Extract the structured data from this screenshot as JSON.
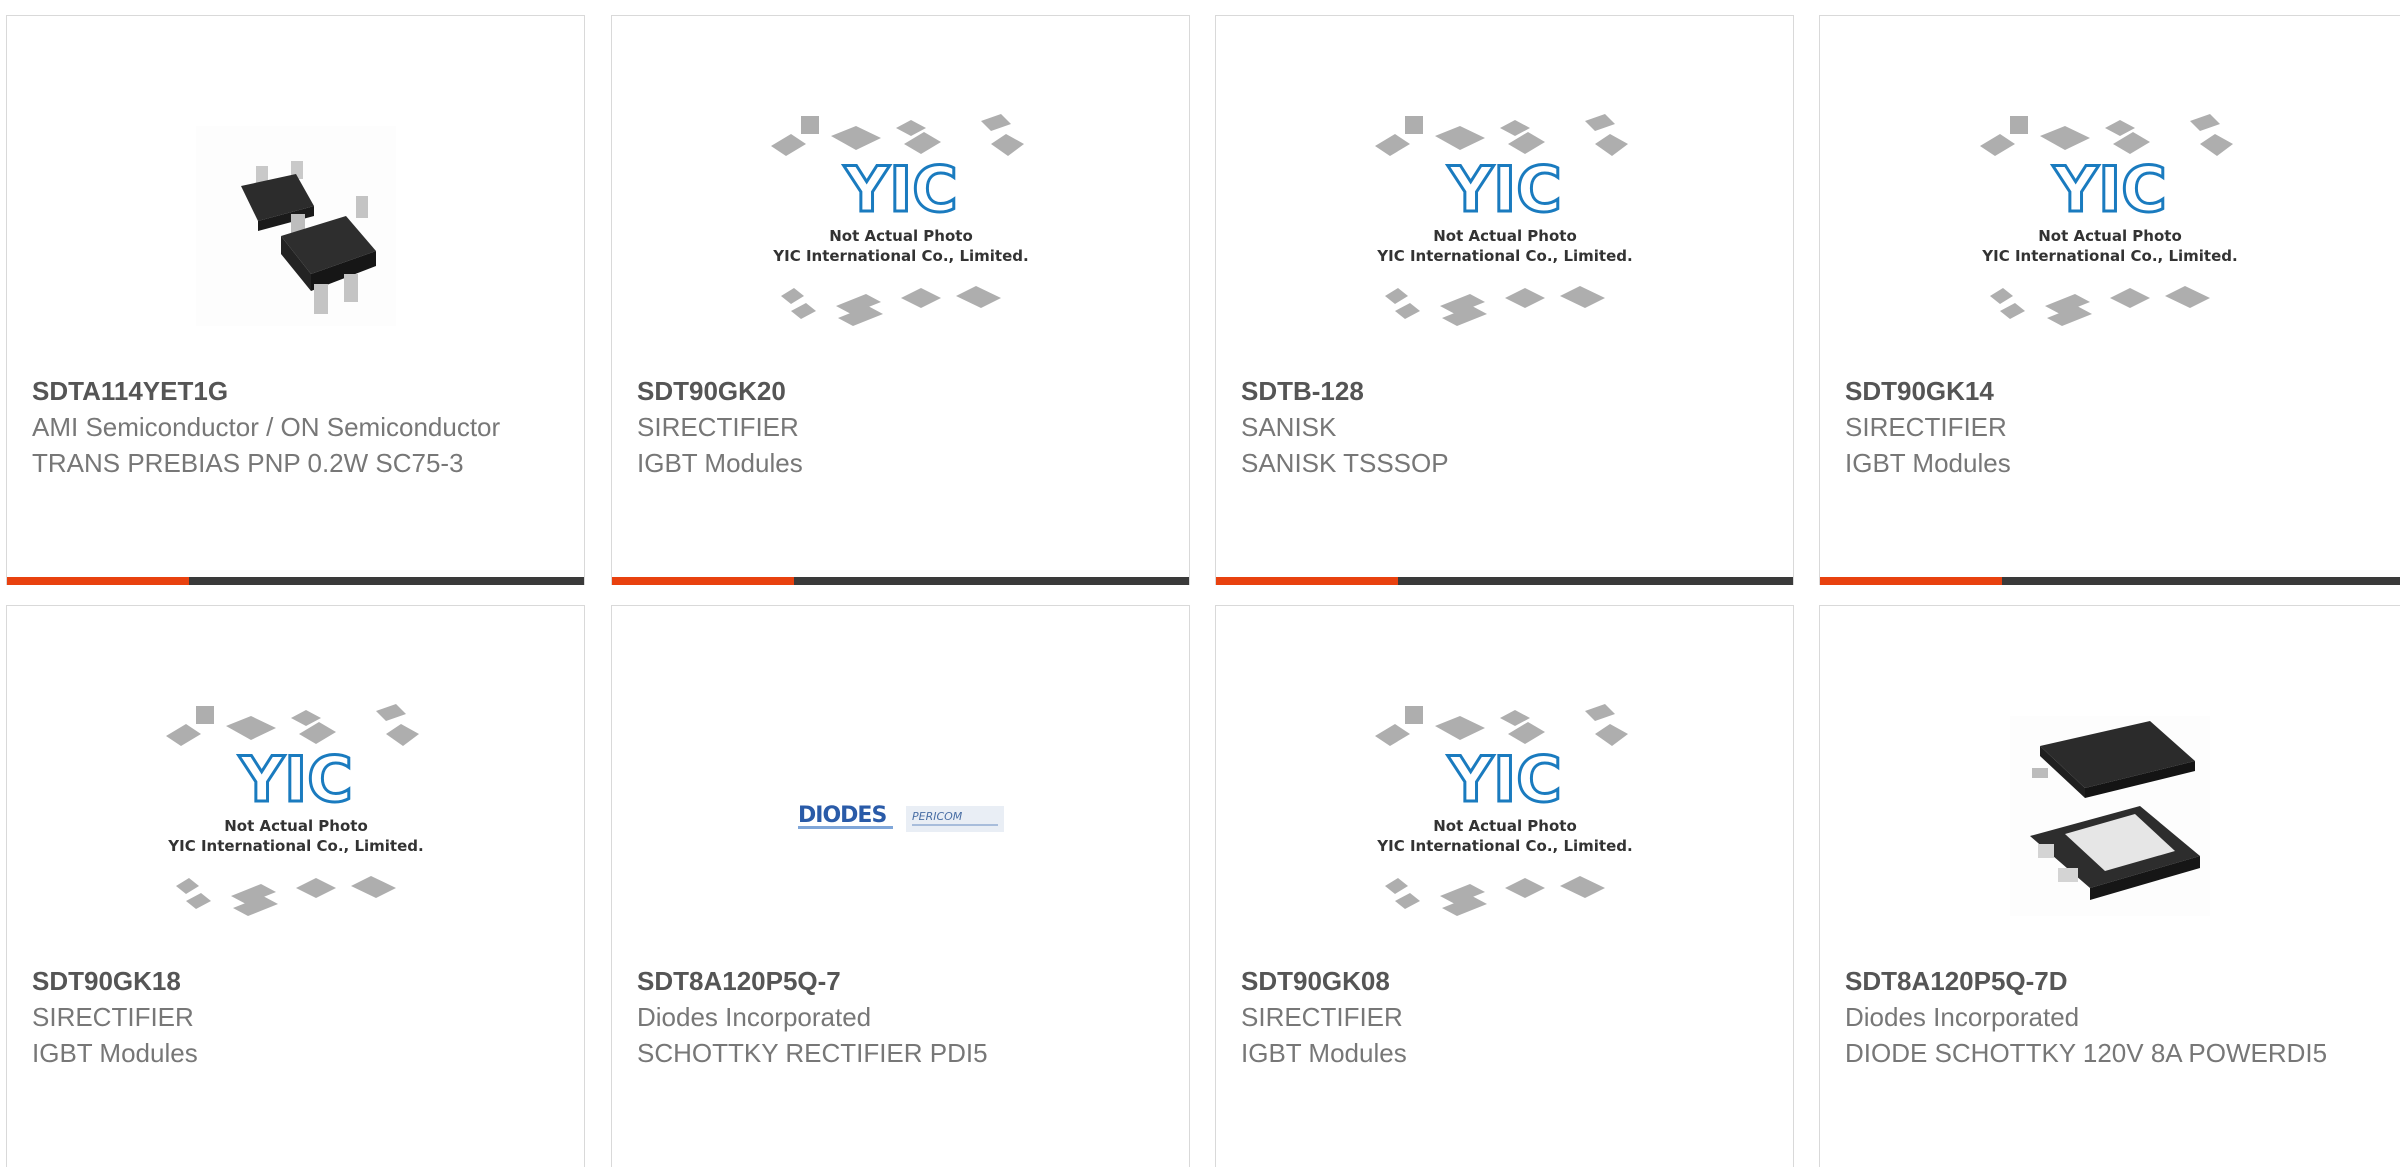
{
  "cards": [
    {
      "part_number": "SDTA114YET1G",
      "manufacturer": "AMI Semiconductor / ON Semiconductor",
      "description": "TRANS PREBIAS PNP 0.2W SC75-3",
      "image": "sc75-package-photo"
    },
    {
      "part_number": "SDT90GK20",
      "manufacturer": "SIRECTIFIER",
      "description": "IGBT Modules",
      "image": "yic-placeholder-photo"
    },
    {
      "part_number": "SDTB-128",
      "manufacturer": "SANISK",
      "description": "SANISK TSSSOP",
      "image": "yic-placeholder-photo"
    },
    {
      "part_number": "SDT90GK14",
      "manufacturer": "SIRECTIFIER",
      "description": "IGBT Modules",
      "image": "yic-placeholder-photo"
    },
    {
      "part_number": "SDT90GK18",
      "manufacturer": "SIRECTIFIER",
      "description": "IGBT Modules",
      "image": "yic-placeholder-photo"
    },
    {
      "part_number": "SDT8A120P5Q-7",
      "manufacturer": "Diodes Incorporated",
      "description": "SCHOTTKY RECTIFIER PDI5",
      "image": "diodes-pericom-logo"
    },
    {
      "part_number": "SDT90GK08",
      "manufacturer": "SIRECTIFIER",
      "description": "IGBT Modules",
      "image": "yic-placeholder-photo"
    },
    {
      "part_number": "SDT8A120P5Q-7D",
      "manufacturer": "Diodes Incorporated",
      "description": "DIODE SCHOTTKY 120V 8A POWERDI5",
      "image": "powerdi5-package-photo"
    }
  ],
  "placeholder": {
    "line1": "Not Actual Photo",
    "line2": "YIC International Co., Limited.",
    "logo_text": "YIC"
  },
  "logos": {
    "diodes": "DIODES",
    "pericom": "PERICOM"
  },
  "colors": {
    "accent": "#e8410f",
    "bar": "#3a3a3a",
    "yic_blue": "#1a7bbf"
  }
}
